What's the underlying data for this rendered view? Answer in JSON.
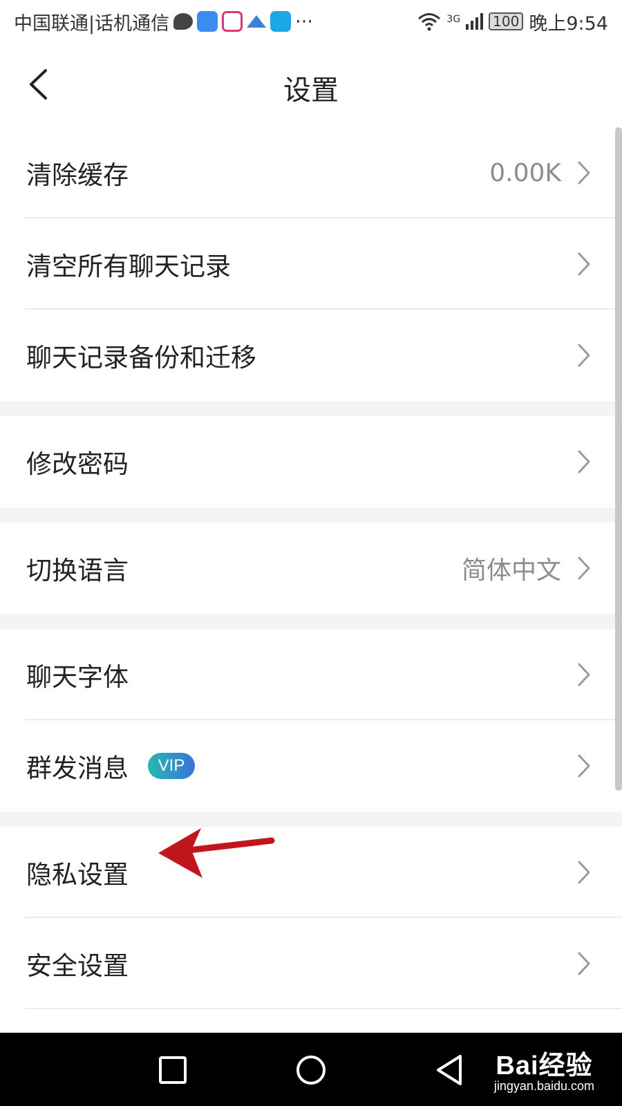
{
  "status_bar": {
    "carrier": "中国联通|话机通信",
    "ellipsis": "···",
    "network": "3G",
    "battery": "100",
    "time": "晚上9:54"
  },
  "header": {
    "title": "设置"
  },
  "settings": {
    "clear_cache": {
      "label": "清除缓存",
      "value": "0.00K"
    },
    "clear_chat": {
      "label": "清空所有聊天记录"
    },
    "backup": {
      "label": "聊天记录备份和迁移"
    },
    "password": {
      "label": "修改密码"
    },
    "language": {
      "label": "切换语言",
      "value": "简体中文"
    },
    "font": {
      "label": "聊天字体"
    },
    "broadcast": {
      "label": "群发消息",
      "badge": "VIP"
    },
    "privacy": {
      "label": "隐私设置"
    },
    "security": {
      "label": "安全设置"
    }
  },
  "watermark": {
    "logo": "Bai经验",
    "url": "jingyan.baidu.com"
  },
  "colors": {
    "annotation_arrow": "#c0161c",
    "vip_gradient_start": "#25b8b0",
    "vip_gradient_end": "#3a73d8",
    "section_gap": "#f4f4f4"
  }
}
